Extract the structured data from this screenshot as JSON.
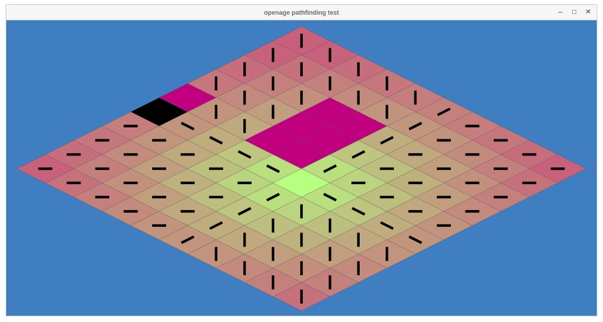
{
  "window": {
    "title": "openage pathfinding test",
    "controls": {
      "minimize_icon": "minimize-icon",
      "maximize_icon": "maximize-icon",
      "close_icon": "close-icon"
    }
  },
  "scene": {
    "background_color": "#3f7fc1",
    "grid_size": 10,
    "target_cell": {
      "row": 5,
      "col": 5
    },
    "start_cell": {
      "row": 5,
      "col": 0
    },
    "colors": {
      "near_target": "#b6ff80",
      "far": "#c8607c",
      "obstacle": "#c0007e",
      "start": "#000000",
      "arrow": "#000000",
      "grid_line": "#555555"
    },
    "obstacles": [
      {
        "row": 4,
        "col": 0
      },
      {
        "row": 2,
        "col": 3
      },
      {
        "row": 2,
        "col": 4
      },
      {
        "row": 3,
        "col": 3
      },
      {
        "row": 3,
        "col": 4
      },
      {
        "row": 4,
        "col": 3
      },
      {
        "row": 4,
        "col": 4
      }
    ]
  }
}
